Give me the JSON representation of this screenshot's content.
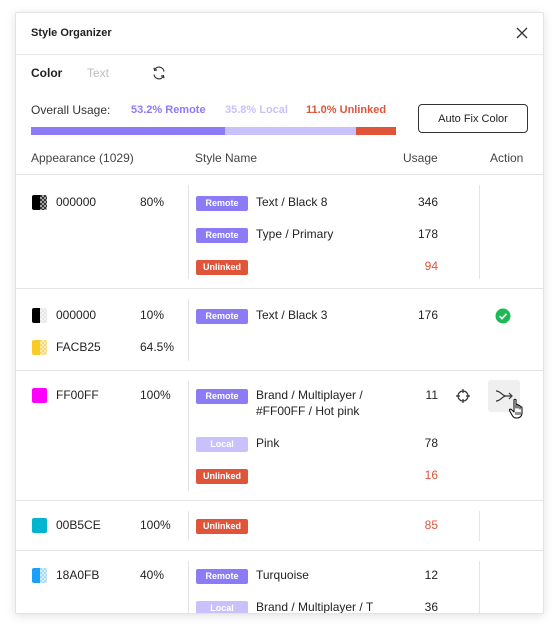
{
  "header": {
    "title": "Style Organizer"
  },
  "tabs": [
    {
      "label": "Color"
    },
    {
      "label": "Text"
    }
  ],
  "usage": {
    "label": "Overall Usage:",
    "remote_label": "53.2% Remote",
    "local_label": "35.8% Local",
    "unlinked_label": "11.0% Unlinked",
    "remote_fraction": 0.532,
    "local_fraction": 0.358,
    "unlinked_fraction": 0.11
  },
  "auto_fix_label": "Auto Fix Color",
  "columns": {
    "appearance": "Appearance (1029)",
    "style_name": "Style Name",
    "usage": "Usage",
    "action": "Action"
  },
  "colors": {
    "remote": "#8B7CF6",
    "local": "#C9C1FB",
    "unlinked": "#E0543A",
    "success": "#1DB954"
  },
  "groups": [
    {
      "appearances": [
        {
          "hex": "000000",
          "opacity": "80%",
          "swatch": "#000000"
        }
      ],
      "styles": [
        {
          "badge": "Remote",
          "name": "Text / Black 8",
          "usage": "346"
        },
        {
          "badge": "Remote",
          "name": "Type / Primary",
          "usage": "178"
        },
        {
          "badge": "Unlinked",
          "name": "",
          "usage": "94"
        }
      ]
    },
    {
      "appearances": [
        {
          "hex": "000000",
          "opacity": "10%",
          "swatch": "#000000"
        },
        {
          "hex": "FACB25",
          "opacity": "64.5%",
          "swatch": "#FACB25"
        }
      ],
      "styles": [
        {
          "badge": "Remote",
          "name": "Text / Black 3",
          "usage": "176"
        }
      ],
      "action_icon": "check-circle-icon"
    },
    {
      "appearances": [
        {
          "hex": "FF00FF",
          "opacity": "100%",
          "swatch": "#FF00FF"
        }
      ],
      "styles": [
        {
          "badge": "Remote",
          "name": "Brand / Multiplayer / #FF00FF / Hot pink",
          "usage": "11"
        },
        {
          "badge": "Local",
          "name": "Pink",
          "usage": "78"
        },
        {
          "badge": "Unlinked",
          "name": "",
          "usage": "16"
        }
      ],
      "action_icon": "merge-icon"
    },
    {
      "appearances": [
        {
          "hex": "00B5CE",
          "opacity": "100%",
          "swatch": "#00B5CE"
        }
      ],
      "styles": [
        {
          "badge": "Unlinked",
          "name": "",
          "usage": "85"
        }
      ]
    },
    {
      "appearances": [
        {
          "hex": "18A0FB",
          "opacity": "40%",
          "swatch": "#18A0FB"
        }
      ],
      "styles": [
        {
          "badge": "Remote",
          "name": "Turquoise",
          "usage": "12"
        },
        {
          "badge": "Local",
          "name": "Brand / Multiplayer / T",
          "usage": "36"
        }
      ]
    }
  ]
}
